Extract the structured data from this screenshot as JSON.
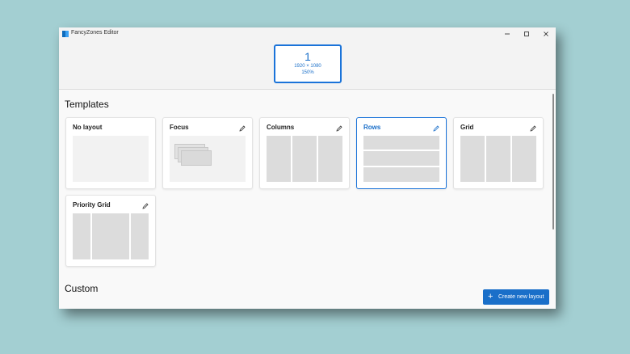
{
  "window": {
    "title": "FancyZones Editor"
  },
  "icons": {
    "app": "fancyzones-app-icon",
    "minimize": "minimize-icon",
    "maximize": "maximize-icon",
    "close": "close-icon",
    "edit": "pencil-icon",
    "add": "plus-icon"
  },
  "monitor": {
    "number": "1",
    "resolution": "1920 × 1080",
    "scale": "150%"
  },
  "templates": {
    "heading": "Templates",
    "cards": [
      {
        "title": "No layout",
        "editable": false,
        "selected": false
      },
      {
        "title": "Focus",
        "editable": true,
        "selected": false
      },
      {
        "title": "Columns",
        "editable": true,
        "selected": false
      },
      {
        "title": "Rows",
        "editable": true,
        "selected": true
      },
      {
        "title": "Grid",
        "editable": true,
        "selected": false
      },
      {
        "title": "Priority Grid",
        "editable": true,
        "selected": false
      }
    ]
  },
  "custom": {
    "heading": "Custom"
  },
  "actions": {
    "create_label": "Create new layout"
  },
  "colors": {
    "accent": "#1a73d9",
    "background": "#a3cfd2"
  }
}
